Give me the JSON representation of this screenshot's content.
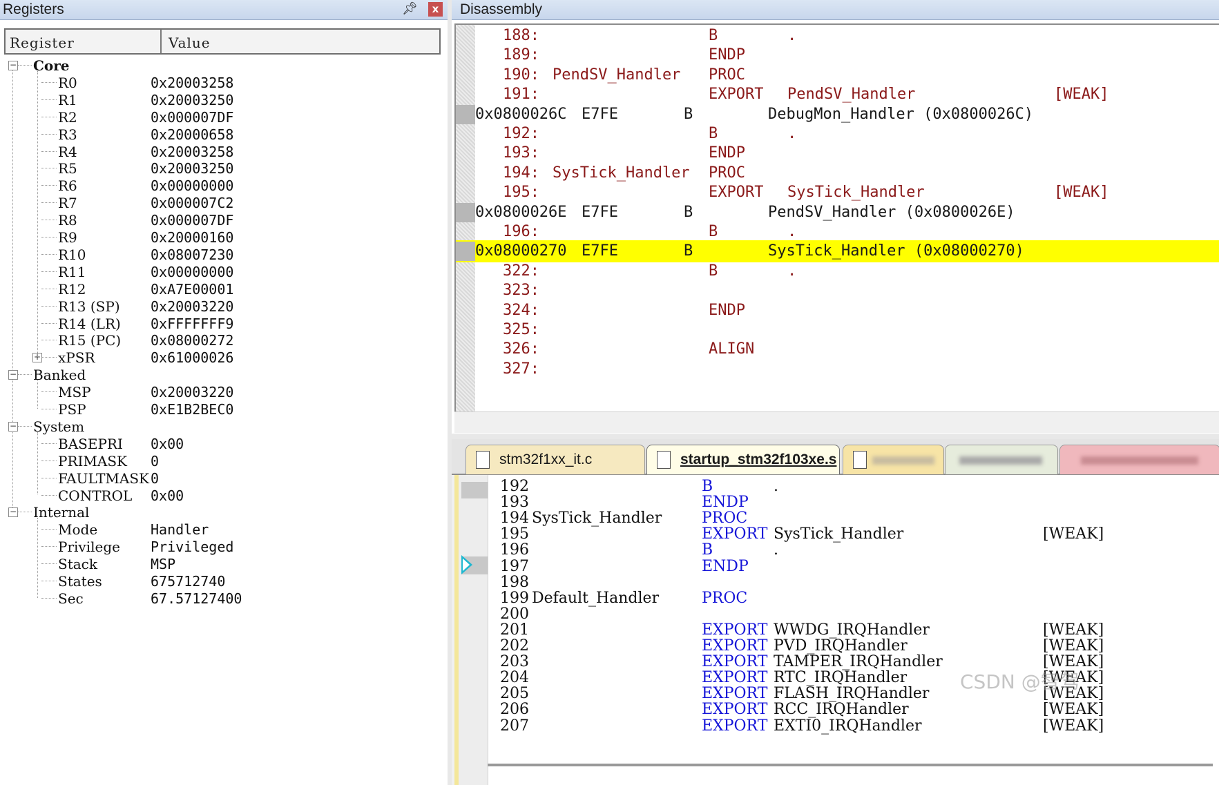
{
  "registers": {
    "title": "Registers",
    "pin_icon": "pin-icon",
    "close_label": "x",
    "col_register": "Register",
    "col_value": "Value",
    "groups": {
      "core": "Core",
      "banked": "Banked",
      "system": "System",
      "internal": "Internal"
    },
    "core": [
      {
        "name": "R0",
        "value": "0x20003258"
      },
      {
        "name": "R1",
        "value": "0x20003250"
      },
      {
        "name": "R2",
        "value": "0x000007DF"
      },
      {
        "name": "R3",
        "value": "0x20000658"
      },
      {
        "name": "R4",
        "value": "0x20003258"
      },
      {
        "name": "R5",
        "value": "0x20003250"
      },
      {
        "name": "R6",
        "value": "0x00000000"
      },
      {
        "name": "R7",
        "value": "0x000007C2"
      },
      {
        "name": "R8",
        "value": "0x000007DF"
      },
      {
        "name": "R9",
        "value": "0x20000160"
      },
      {
        "name": "R10",
        "value": "0x08007230"
      },
      {
        "name": "R11",
        "value": "0x00000000"
      },
      {
        "name": "R12",
        "value": "0xA7E00001"
      },
      {
        "name": "R13 (SP)",
        "value": "0x20003220"
      },
      {
        "name": "R14 (LR)",
        "value": "0xFFFFFFF9"
      },
      {
        "name": "R15 (PC)",
        "value": "0x08000272"
      },
      {
        "name": "xPSR",
        "value": "0x61000026"
      }
    ],
    "banked": [
      {
        "name": "MSP",
        "value": "0x20003220"
      },
      {
        "name": "PSP",
        "value": "0xE1B2BEC0"
      }
    ],
    "system": [
      {
        "name": "BASEPRI",
        "value": "0x00"
      },
      {
        "name": "PRIMASK",
        "value": "0"
      },
      {
        "name": "FAULTMASK",
        "value": "0"
      },
      {
        "name": "CONTROL",
        "value": "0x00"
      }
    ],
    "internal": [
      {
        "name": "Mode",
        "value": "Handler"
      },
      {
        "name": "Privilege",
        "value": "Privileged"
      },
      {
        "name": "Stack",
        "value": "MSP"
      },
      {
        "name": "States",
        "value": "675712740"
      },
      {
        "name": "Sec",
        "value": "67.57127400"
      }
    ]
  },
  "disassembly": {
    "title": "Disassembly",
    "lines": [
      {
        "kind": "src",
        "num": "188:",
        "label": "",
        "op": "B",
        "arg": ".",
        "weak": ""
      },
      {
        "kind": "src",
        "num": "189:",
        "label": "",
        "op": "ENDP",
        "arg": "",
        "weak": ""
      },
      {
        "kind": "src",
        "num": "190:",
        "label": "PendSV_Handler",
        "op": "PROC",
        "arg": "",
        "weak": ""
      },
      {
        "kind": "src",
        "num": "191:",
        "label": "",
        "op": "EXPORT",
        "arg": "PendSV_Handler",
        "weak": "[WEAK]"
      },
      {
        "kind": "addr",
        "addr": "0x0800026C",
        "code": "E7FE",
        "op": "B",
        "arg": "DebugMon_Handler (0x0800026C)"
      },
      {
        "kind": "src",
        "num": "192:",
        "label": "",
        "op": "B",
        "arg": ".",
        "weak": ""
      },
      {
        "kind": "src",
        "num": "193:",
        "label": "",
        "op": "ENDP",
        "arg": "",
        "weak": ""
      },
      {
        "kind": "src",
        "num": "194:",
        "label": "SysTick_Handler",
        "op": "PROC",
        "arg": "",
        "weak": ""
      },
      {
        "kind": "src",
        "num": "195:",
        "label": "",
        "op": "EXPORT",
        "arg": "SysTick_Handler",
        "weak": "[WEAK]"
      },
      {
        "kind": "addr",
        "addr": "0x0800026E",
        "code": "E7FE",
        "op": "B",
        "arg": "PendSV_Handler (0x0800026E)"
      },
      {
        "kind": "src",
        "num": "196:",
        "label": "",
        "op": "B",
        "arg": ".",
        "weak": ""
      },
      {
        "kind": "addr",
        "addr": "0x08000270",
        "code": "E7FE",
        "op": "B",
        "arg": "SysTick_Handler (0x08000270)",
        "highlight": true
      },
      {
        "kind": "src",
        "num": "322:",
        "label": "",
        "op": "B",
        "arg": ".",
        "weak": ""
      },
      {
        "kind": "src",
        "num": "323:",
        "label": "",
        "op": "",
        "arg": "",
        "weak": ""
      },
      {
        "kind": "src",
        "num": "324:",
        "label": "",
        "op": "ENDP",
        "arg": "",
        "weak": ""
      },
      {
        "kind": "src",
        "num": "325:",
        "label": "",
        "op": "",
        "arg": "",
        "weak": ""
      },
      {
        "kind": "src",
        "num": "326:",
        "label": "",
        "op": "ALIGN",
        "arg": "",
        "weak": ""
      },
      {
        "kind": "src",
        "num": "327:",
        "label": "",
        "op": "",
        "arg": "",
        "weak": ""
      }
    ]
  },
  "editor": {
    "tabs": [
      {
        "label": "stm32f1xx_it.c",
        "active": false
      },
      {
        "label": "startup_stm32f103xe.s",
        "active": true
      }
    ],
    "lines": [
      {
        "num": "192",
        "label": "",
        "kw": "B",
        "op": ".",
        "weak": ""
      },
      {
        "num": "193",
        "label": "",
        "kw": "ENDP",
        "op": "",
        "weak": ""
      },
      {
        "num": "194",
        "label": "SysTick_Handler",
        "kw": "PROC",
        "op": "",
        "weak": ""
      },
      {
        "num": "195",
        "label": "",
        "kw": "EXPORT",
        "op": "SysTick_Handler",
        "weak": "[WEAK]"
      },
      {
        "num": "196",
        "label": "",
        "kw": "B",
        "op": ".",
        "weak": ""
      },
      {
        "num": "197",
        "label": "",
        "kw": "ENDP",
        "op": "",
        "weak": ""
      },
      {
        "num": "198",
        "label": "",
        "kw": "",
        "op": "",
        "weak": ""
      },
      {
        "num": "199",
        "label": "Default_Handler",
        "kw": "PROC",
        "op": "",
        "weak": ""
      },
      {
        "num": "200",
        "label": "",
        "kw": "",
        "op": "",
        "weak": ""
      },
      {
        "num": "201",
        "label": "",
        "kw": "EXPORT",
        "op": "WWDG_IRQHandler",
        "weak": "[WEAK]"
      },
      {
        "num": "202",
        "label": "",
        "kw": "EXPORT",
        "op": "PVD_IRQHandler",
        "weak": "[WEAK]"
      },
      {
        "num": "203",
        "label": "",
        "kw": "EXPORT",
        "op": "TAMPER_IRQHandler",
        "weak": "[WEAK]"
      },
      {
        "num": "204",
        "label": "",
        "kw": "EXPORT",
        "op": "RTC_IRQHandler",
        "weak": "[WEAK]"
      },
      {
        "num": "205",
        "label": "",
        "kw": "EXPORT",
        "op": "FLASH_IRQHandler",
        "weak": "[WEAK]"
      },
      {
        "num": "206",
        "label": "",
        "kw": "EXPORT",
        "op": "RCC_IRQHandler",
        "weak": "[WEAK]"
      },
      {
        "num": "207",
        "label": "",
        "kw": "EXPORT",
        "op": "EXTI0_IRQHandler",
        "weak": "[WEAK]"
      }
    ],
    "watermark": "CSDN @智驾"
  }
}
